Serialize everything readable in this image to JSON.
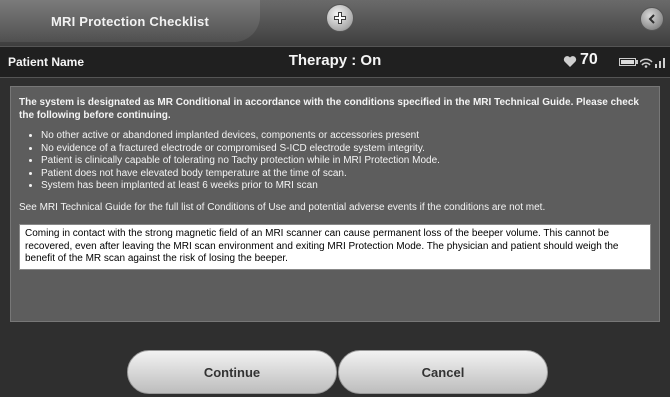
{
  "header": {
    "title": "MRI Protection Checklist",
    "center_icon": "plus-badge-icon",
    "back_icon": "back-arrow-icon"
  },
  "status_bar": {
    "patient_label": "Patient Name",
    "therapy": "Therapy : On",
    "heart_rate": "70",
    "heart_icon": "heart-icon",
    "battery_icon": "battery-icon",
    "signal_icon": "signal-icon"
  },
  "content": {
    "intro": "The system is designated as MR Conditional in accordance with the conditions specified in the MRI Technical Guide. Please check the following before continuing.",
    "conditions": [
      "No other active or abandoned implanted devices, components or accessories present",
      "No evidence of a fractured electrode or compromised S-ICD electrode system integrity.",
      "Patient is clinically capable of tolerating no Tachy protection while in MRI Protection Mode.",
      "Patient does not have elevated body temperature at the time of scan.",
      "System has been implanted at least 6 weeks prior to MRI scan"
    ],
    "see_guide": "See MRI Technical Guide for the full list of Conditions of Use and potential adverse events if the conditions are not met.",
    "warning": "Coming in contact with the strong magnetic field of an MRI scanner can cause permanent loss of the beeper volume. This cannot be recovered, even after leaving the MRI scan environment and exiting MRI Protection Mode. The physician and patient should weigh the benefit of the MR scan against the risk of losing the beeper."
  },
  "buttons": {
    "continue": "Continue",
    "cancel": "Cancel"
  },
  "colors": {
    "panel": "#5d5d5d",
    "patient_bar": "#202020",
    "warning_bg": "#ffffff"
  }
}
